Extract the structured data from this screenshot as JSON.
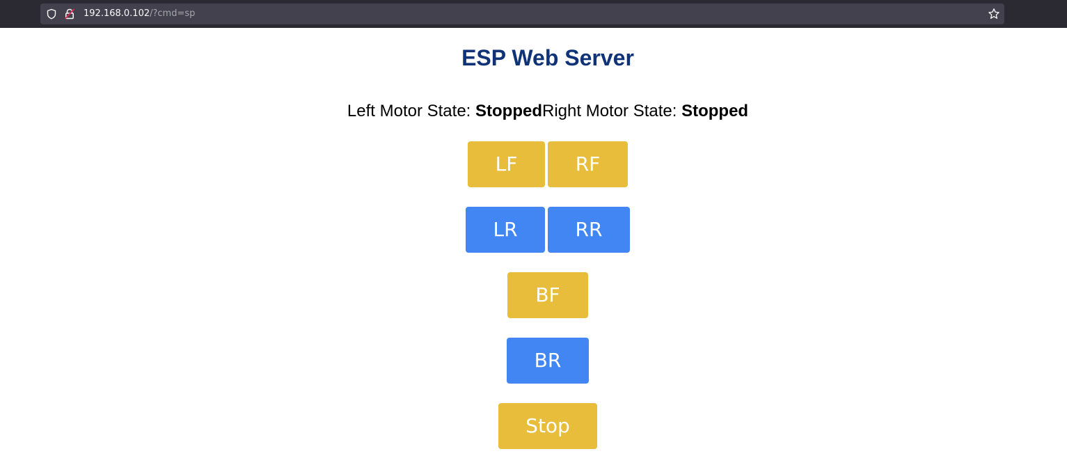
{
  "browser": {
    "url_host": "192.168.0.102",
    "url_path": "/?cmd=sp"
  },
  "page": {
    "title": "ESP Web Server",
    "left_motor_label": "Left Motor State: ",
    "left_motor_state": "Stopped",
    "right_motor_label": "Right Motor State: ",
    "right_motor_state": "Stopped"
  },
  "buttons": {
    "lf": "LF",
    "rf": "RF",
    "lr": "LR",
    "rr": "RR",
    "bf": "BF",
    "br": "BR",
    "stop": "Stop"
  },
  "colors": {
    "title": "#0f3376",
    "forward_button": "#e7bd3b",
    "reverse_button": "#4286f4"
  }
}
